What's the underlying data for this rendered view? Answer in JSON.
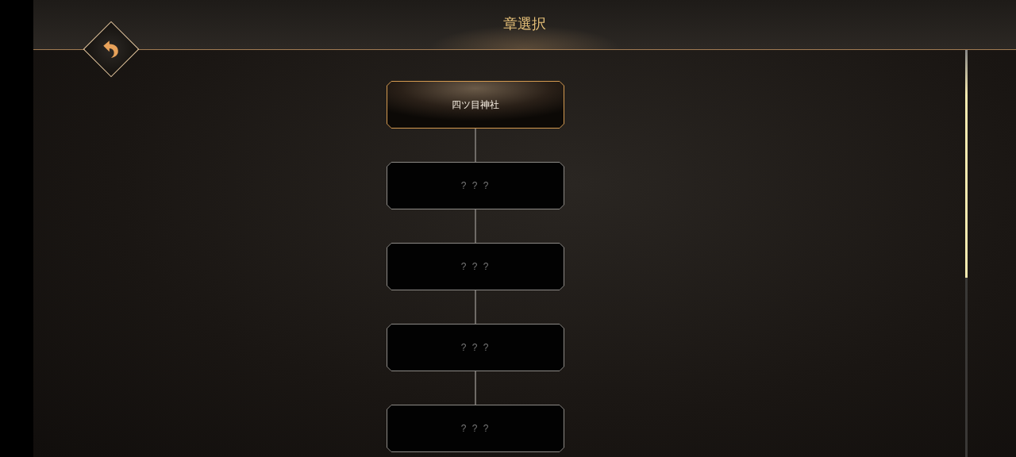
{
  "header": {
    "title": "章選択"
  },
  "chapters": [
    {
      "label": "四ツ目神社",
      "selected": true
    },
    {
      "label": "? ? ?",
      "selected": false
    },
    {
      "label": "? ? ?",
      "selected": false
    },
    {
      "label": "? ? ?",
      "selected": false
    },
    {
      "label": "? ? ?",
      "selected": false
    }
  ]
}
